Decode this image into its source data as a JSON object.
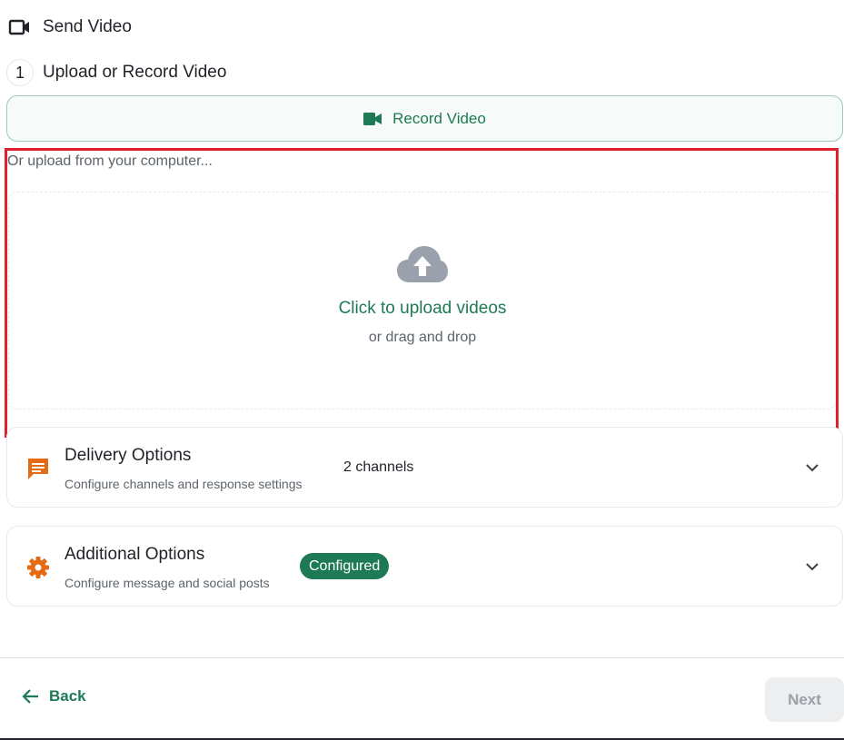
{
  "header": {
    "title": "Send Video",
    "icon": "video-camera-outline-icon"
  },
  "step": {
    "number": "1",
    "title": "Upload or Record Video"
  },
  "record": {
    "label": "Record Video",
    "icon": "video-camera-icon"
  },
  "upload": {
    "hint": "Or upload from your computer...",
    "primary": "Click to upload videos",
    "secondary": "or drag and drop",
    "icon": "cloud-upload-icon"
  },
  "delivery": {
    "title": "Delivery Options",
    "subtitle": "Configure channels and response settings",
    "meta": "2 channels",
    "icon": "message-icon"
  },
  "additional": {
    "title": "Additional Options",
    "subtitle": "Configure message and social posts",
    "badge": "Configured",
    "icon": "gear-icon"
  },
  "footer": {
    "back": "Back",
    "next": "Next"
  },
  "colors": {
    "accent": "#1e7a55",
    "highlight": "#e0202b",
    "icon_orange": "#e56a12",
    "cloud_gray": "#9aa1ac"
  }
}
